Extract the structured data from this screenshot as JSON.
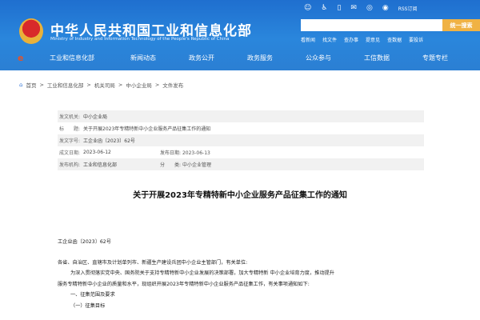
{
  "header": {
    "title": "中华人民共和国工业和信息化部",
    "subtitle": "Ministry of Industry and Information Technology of the People's Republic of China",
    "tools": [
      "robot-icon",
      "accessibility-icon",
      "mobile-icon",
      "mail-icon",
      "wechat-icon",
      "weibo-icon"
    ],
    "rss": "RSS订阅",
    "search_placeholder": "",
    "search_button": "统一搜索",
    "quick_links": [
      "看新闻",
      "找文件",
      "查办事",
      "提意见",
      "查数据",
      "要投诉"
    ]
  },
  "nav": {
    "items": [
      "工业和信息化部",
      "新闻动态",
      "政务公开",
      "政务服务",
      "公众参与",
      "工信数据",
      "专题专栏"
    ]
  },
  "breadcrumb": [
    "首页",
    "工业和信息化部",
    "机关司局",
    "中小企业局",
    "文件发布"
  ],
  "meta": {
    "issuer_k": "发文机关:",
    "issuer": "中小企业局",
    "title_k": "标　　题:",
    "title": "关于开展2023年专精特新中小企业服务产品征集工作的通知",
    "no_k": "发文字号:",
    "no": "工企业函〔2023〕62号",
    "date_k": "成文日期:",
    "date": "2023-06-12",
    "pub_k": "发布日期:",
    "pub": "2023-06-13",
    "org_k": "发布机构:",
    "org": "工业和信息化部",
    "cat_k": "分　　类:",
    "cat": "中小企业管理"
  },
  "doc": {
    "title": "关于开展2023年专精特新中小企业服务产品征集工作的通知",
    "number": "工企业函〔2023〕62号",
    "salutation": "各省、自治区、直辖市及计划单列市、新疆生产建设兵团中小企业主管部门，有关单位:",
    "p1a": "为深入贯彻落实党中央、国务院关于支持专精特新中小企业发展的决策部署，加大专精特新 中小企业培育力度，推动提升",
    "p1b": "服务专精特新中小企业的质量和水平，现组织开展2023年专精特新中小企业服务产品征集工作，有关事项通知如下:",
    "h1": "一、征集范围及要求",
    "h2": "（一）征集目标"
  }
}
